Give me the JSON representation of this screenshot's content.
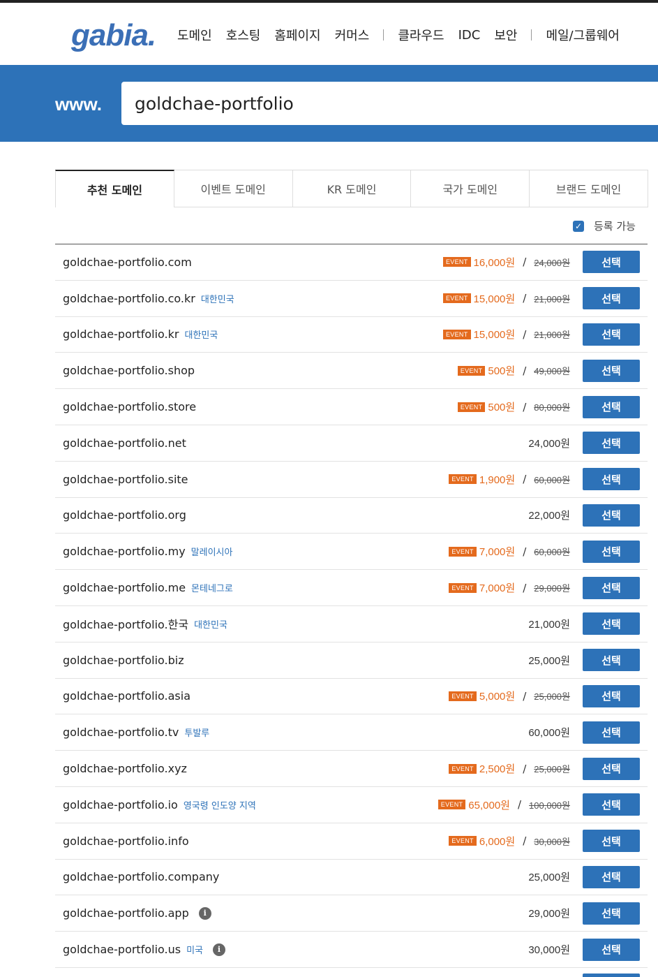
{
  "header": {
    "logo": "gabia.",
    "nav": [
      "도메인",
      "호스팅",
      "홈페이지",
      "커머스",
      "클라우드",
      "IDC",
      "보안",
      "메일/그룹웨어"
    ]
  },
  "search": {
    "prefix": "www.",
    "value": "goldchae-portfolio"
  },
  "tabs": [
    "추천 도메인",
    "이벤트 도메인",
    "KR 도메인",
    "국가 도메인",
    "브랜드 도메인"
  ],
  "filter": {
    "label": "등록 가능",
    "checked": true
  },
  "button_label": "선택",
  "event_badge": "EVENT",
  "domains": [
    {
      "name": "goldchae-portfolio.com",
      "country": "",
      "info": false,
      "event": true,
      "price": "16,000원",
      "orig": "24,000원"
    },
    {
      "name": "goldchae-portfolio.co.kr",
      "country": "대한민국",
      "info": false,
      "event": true,
      "price": "15,000원",
      "orig": "21,000원"
    },
    {
      "name": "goldchae-portfolio.kr",
      "country": "대한민국",
      "info": false,
      "event": true,
      "price": "15,000원",
      "orig": "21,000원"
    },
    {
      "name": "goldchae-portfolio.shop",
      "country": "",
      "info": false,
      "event": true,
      "price": "500원",
      "orig": "49,000원"
    },
    {
      "name": "goldchae-portfolio.store",
      "country": "",
      "info": false,
      "event": true,
      "price": "500원",
      "orig": "80,000원"
    },
    {
      "name": "goldchae-portfolio.net",
      "country": "",
      "info": false,
      "event": false,
      "price": "24,000원",
      "orig": ""
    },
    {
      "name": "goldchae-portfolio.site",
      "country": "",
      "info": false,
      "event": true,
      "price": "1,900원",
      "orig": "60,000원"
    },
    {
      "name": "goldchae-portfolio.org",
      "country": "",
      "info": false,
      "event": false,
      "price": "22,000원",
      "orig": ""
    },
    {
      "name": "goldchae-portfolio.my",
      "country": "말레이시아",
      "info": false,
      "event": true,
      "price": "7,000원",
      "orig": "60,000원"
    },
    {
      "name": "goldchae-portfolio.me",
      "country": "몬테네그로",
      "info": false,
      "event": true,
      "price": "7,000원",
      "orig": "29,000원"
    },
    {
      "name": "goldchae-portfolio.한국",
      "country": "대한민국",
      "info": false,
      "event": false,
      "price": "21,000원",
      "orig": ""
    },
    {
      "name": "goldchae-portfolio.biz",
      "country": "",
      "info": false,
      "event": false,
      "price": "25,000원",
      "orig": ""
    },
    {
      "name": "goldchae-portfolio.asia",
      "country": "",
      "info": false,
      "event": true,
      "price": "5,000원",
      "orig": "25,000원"
    },
    {
      "name": "goldchae-portfolio.tv",
      "country": "투발루",
      "info": false,
      "event": false,
      "price": "60,000원",
      "orig": ""
    },
    {
      "name": "goldchae-portfolio.xyz",
      "country": "",
      "info": false,
      "event": true,
      "price": "2,500원",
      "orig": "25,000원"
    },
    {
      "name": "goldchae-portfolio.io",
      "country": "영국령 인도양 지역",
      "info": false,
      "event": true,
      "price": "65,000원",
      "orig": "100,000원"
    },
    {
      "name": "goldchae-portfolio.info",
      "country": "",
      "info": false,
      "event": true,
      "price": "6,000원",
      "orig": "30,000원"
    },
    {
      "name": "goldchae-portfolio.company",
      "country": "",
      "info": false,
      "event": false,
      "price": "25,000원",
      "orig": ""
    },
    {
      "name": "goldchae-portfolio.app",
      "country": "",
      "info": true,
      "event": false,
      "price": "29,000원",
      "orig": ""
    },
    {
      "name": "goldchae-portfolio.us",
      "country": "미국",
      "info": true,
      "event": false,
      "price": "30,000원",
      "orig": ""
    }
  ],
  "colors": {
    "brand": "#2d72b8",
    "event": "#e46a1d"
  }
}
